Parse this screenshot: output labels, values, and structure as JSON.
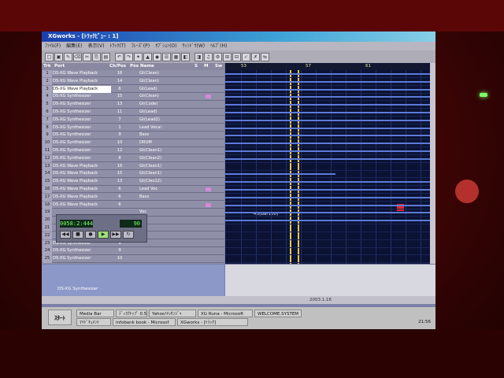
{
  "window": {
    "title": "XGworks - [ﾄﾗｯｸﾋﾞｭｰ : 1]"
  },
  "menubar": [
    "ﾌｧｲﾙ(F)",
    "編集(E)",
    "表示(V)",
    "ﾄﾗｯｸ(T)",
    "ﾌﾚｰｽﾞ(P)",
    "ｵﾌﾟｼｮﾝ(O)",
    "ｳｨﾝﾄﾞｳ(W)",
    "ﾍﾙﾌﾟ(H)"
  ],
  "track_header": {
    "trk": "Trk",
    "port": "Port",
    "ch_pos": "Ch/Pos",
    "name": "Pos Name",
    "s": "S",
    "m": "M",
    "sw": "Sw"
  },
  "ruler": [
    "53",
    "57",
    "61"
  ],
  "tracks": [
    {
      "num": "1",
      "port": "DS-XG Wave Playback",
      "ch": "16",
      "name": "Gt(Clean)"
    },
    {
      "num": "2",
      "port": "DS-XG Wave Playback",
      "ch": "14",
      "name": "Gt(Clean)"
    },
    {
      "num": "3",
      "port": "DS-XG Wave Playback",
      "ch": "6",
      "name": "Gt(Lead)"
    },
    {
      "num": "4",
      "port": "DS-XG Synthesizer",
      "ch": "15",
      "name": "Gt(Clean)"
    },
    {
      "num": "5",
      "port": "DS-XG Synthesizer",
      "ch": "13",
      "name": "Gt(Code)"
    },
    {
      "num": "6",
      "port": "DS-XG Synthesizer",
      "ch": "11",
      "name": "Gt(Lead)"
    },
    {
      "num": "7",
      "port": "DS-XG Synthesizer",
      "ch": "7",
      "name": "Gt(Lead2)"
    },
    {
      "num": "8",
      "port": "DS-XG Synthesizer",
      "ch": "1",
      "name": "Lead Vocal"
    },
    {
      "num": "9",
      "port": "DS-XG Synthesizer",
      "ch": "9",
      "name": "Bass"
    },
    {
      "num": "10",
      "port": "DS-XG Synthesizer",
      "ch": "10",
      "name": "DRUM"
    },
    {
      "num": "11",
      "port": "DS-XG Synthesizer",
      "ch": "12",
      "name": "Gt(Clean1)"
    },
    {
      "num": "12",
      "port": "DS-XG Synthesizer",
      "ch": "8",
      "name": "Gt(Clean2)"
    },
    {
      "num": "13",
      "port": "DS-XG Wave Playback",
      "ch": "16",
      "name": "Gt(Clean1)"
    },
    {
      "num": "14",
      "port": "DS-XG Wave Playback",
      "ch": "15",
      "name": "Gt(Clean1)"
    },
    {
      "num": "15",
      "port": "DS-XG Wave Playback",
      "ch": "13",
      "name": "Gt(Cleo12)"
    },
    {
      "num": "16",
      "port": "DS-XG Wave Playback",
      "ch": "6",
      "name": "Lead Voc"
    },
    {
      "num": "17",
      "port": "DS-XG Wave Playback",
      "ch": "6",
      "name": "Bass"
    },
    {
      "num": "18",
      "port": "DS-XG Wave Playback",
      "ch": "6",
      "name": ""
    },
    {
      "num": "19",
      "port": "",
      "ch": "",
      "name": "Voc"
    },
    {
      "num": "20",
      "port": "",
      "ch": "",
      "name": ""
    },
    {
      "num": "21",
      "port": "",
      "ch": "",
      "name": ""
    },
    {
      "num": "22",
      "port": "",
      "ch": "",
      "name": ""
    },
    {
      "num": "23",
      "port": "DS-XG Synthesizer",
      "ch": "9",
      "name": ""
    },
    {
      "num": "24",
      "port": "DS-XG Synthesizer",
      "ch": "9",
      "name": ""
    },
    {
      "num": "25",
      "port": "DS-XG Synthesizer",
      "ch": "10",
      "name": ""
    }
  ],
  "transport": {
    "location": "0058:2:444",
    "tempo": "90"
  },
  "grid_label": "→3(Bar100)",
  "lower": {
    "label": "DS-XG Synthesizer"
  },
  "status": {
    "text": "2003.1.16",
    "zoom": ""
  },
  "taskbar": {
    "start": "ｽﾀｰﾄ",
    "tasks": [
      "Media Bar",
      "ﾃﾞｨｽｸﾄｯﾌﾟ 0.5",
      "Yahoo!ﾒｯｾﾝｼﾞｬ",
      "XG Runa - Microsoft",
      "WELCOME.SYSTEM",
      "ﾏｲﾄﾞｷｭﾒﾝﾄ",
      "infobank book - Microsof",
      "XGworks - [ﾄﾗｯｸ]"
    ],
    "clock": "21:56"
  },
  "colors": {
    "accent": "#3a54c8",
    "lane": "#5c7ad8",
    "cursor": "#e8c84a",
    "event": "#e8202a"
  }
}
